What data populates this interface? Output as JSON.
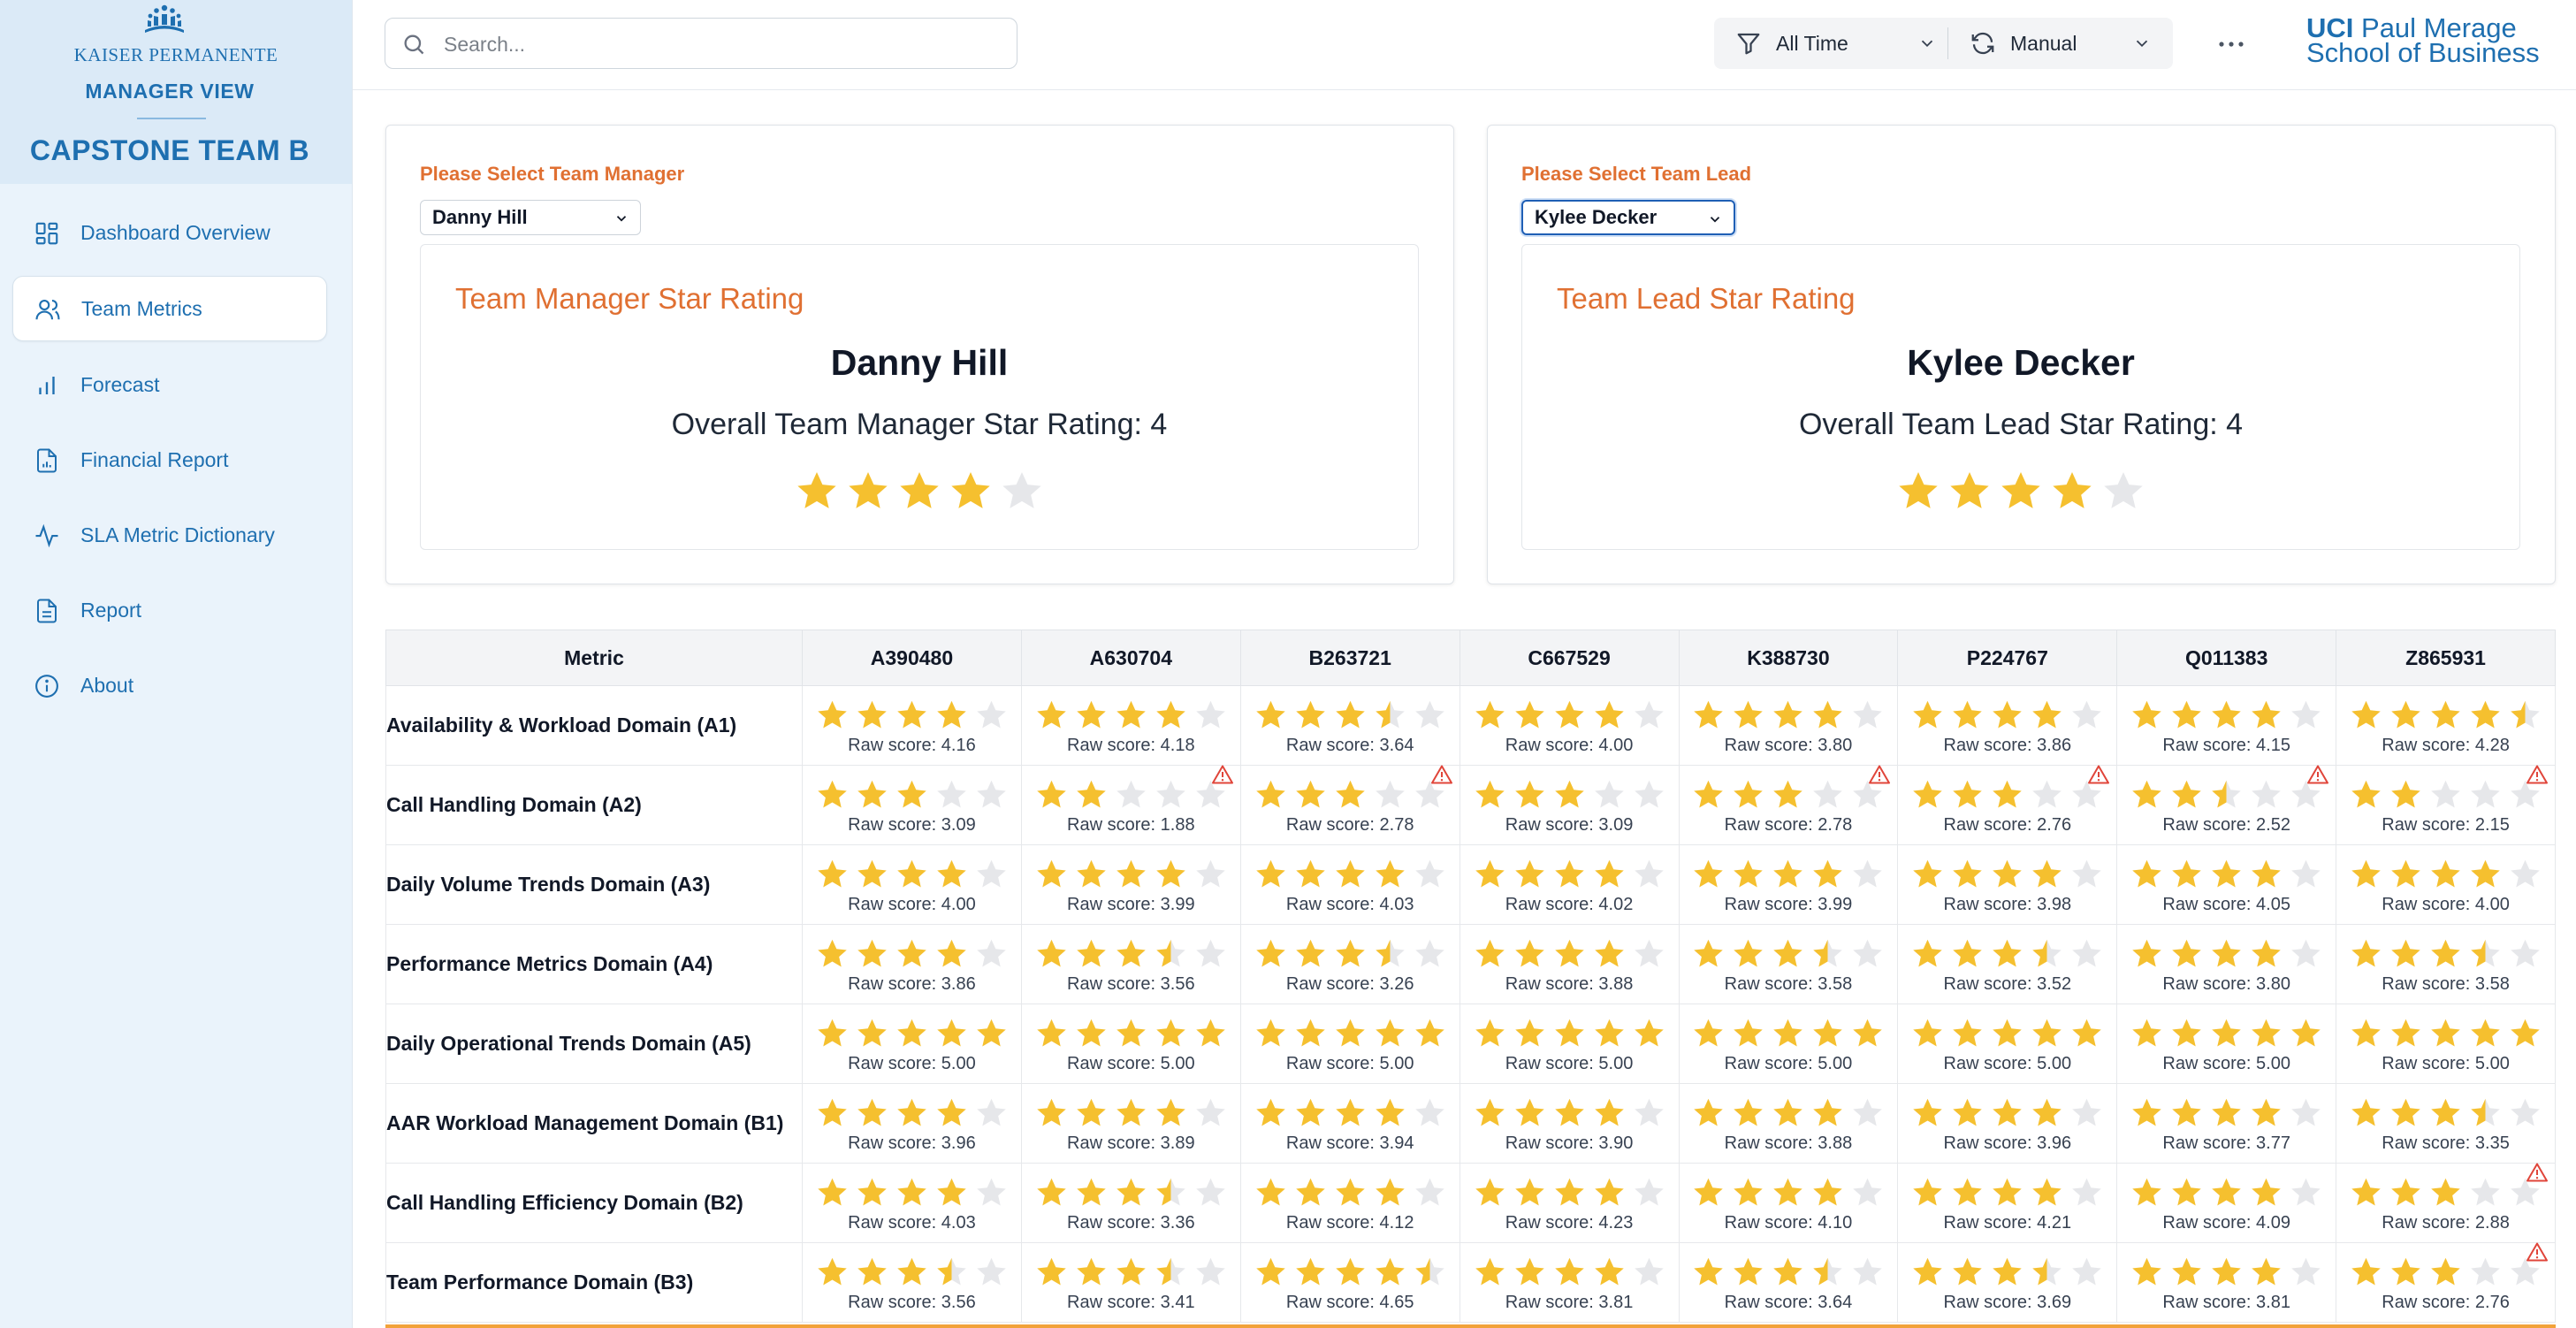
{
  "brand": {
    "org": "KAISER PERMANENTE",
    "view": "MANAGER VIEW",
    "team": "CAPSTONE TEAM B"
  },
  "nav": [
    {
      "label": "Dashboard Overview",
      "icon": "dashboard-icon",
      "active": false
    },
    {
      "label": "Team Metrics",
      "icon": "users-icon",
      "active": true
    },
    {
      "label": "Forecast",
      "icon": "bar-chart-icon",
      "active": false
    },
    {
      "label": "Financial Report",
      "icon": "file-chart-icon",
      "active": false
    },
    {
      "label": "SLA Metric Dictionary",
      "icon": "activity-icon",
      "active": false
    },
    {
      "label": "Report",
      "icon": "file-text-icon",
      "active": false
    },
    {
      "label": "About",
      "icon": "info-icon",
      "active": false
    }
  ],
  "header": {
    "search_placeholder": "Search...",
    "time_filter": "All Time",
    "refresh_mode": "Manual",
    "school_logo_line1_bold": "UCI",
    "school_logo_line1_rest": "Paul Merage",
    "school_logo_line2": "School of Business"
  },
  "manager_panel": {
    "select_label": "Please Select Team Manager",
    "selected": "Danny Hill",
    "card_title": "Team Manager Star Rating",
    "name": "Danny Hill",
    "overall_text": "Overall Team Manager Star Rating: 4",
    "rating": 4
  },
  "lead_panel": {
    "select_label": "Please Select Team Lead",
    "selected": "Kylee Decker",
    "card_title": "Team Lead Star Rating",
    "name": "Kylee Decker",
    "overall_text": "Overall Team Lead Star Rating: 4",
    "rating": 4
  },
  "table": {
    "metric_header": "Metric",
    "raw_prefix": "Raw score: ",
    "columns": [
      "A390480",
      "A630704",
      "B263721",
      "C667529",
      "K388730",
      "P224767",
      "Q011383",
      "Z865931"
    ],
    "rows": [
      {
        "metric": "Availability & Workload Domain (A1)",
        "cells": [
          {
            "stars": 4,
            "raw": "4.16",
            "warn": false
          },
          {
            "stars": 4,
            "raw": "4.18",
            "warn": false
          },
          {
            "stars": 3.5,
            "raw": "3.64",
            "warn": false
          },
          {
            "stars": 4,
            "raw": "4.00",
            "warn": false
          },
          {
            "stars": 4,
            "raw": "3.80",
            "warn": false
          },
          {
            "stars": 4,
            "raw": "3.86",
            "warn": false
          },
          {
            "stars": 4,
            "raw": "4.15",
            "warn": false
          },
          {
            "stars": 4.5,
            "raw": "4.28",
            "warn": false
          }
        ]
      },
      {
        "metric": "Call Handling Domain (A2)",
        "cells": [
          {
            "stars": 3,
            "raw": "3.09",
            "warn": false
          },
          {
            "stars": 2,
            "raw": "1.88",
            "warn": true
          },
          {
            "stars": 3,
            "raw": "2.78",
            "warn": true
          },
          {
            "stars": 3,
            "raw": "3.09",
            "warn": false
          },
          {
            "stars": 3,
            "raw": "2.78",
            "warn": true
          },
          {
            "stars": 3,
            "raw": "2.76",
            "warn": true
          },
          {
            "stars": 2.5,
            "raw": "2.52",
            "warn": true
          },
          {
            "stars": 2,
            "raw": "2.15",
            "warn": true
          }
        ]
      },
      {
        "metric": "Daily Volume Trends Domain (A3)",
        "cells": [
          {
            "stars": 4,
            "raw": "4.00",
            "warn": false
          },
          {
            "stars": 4,
            "raw": "3.99",
            "warn": false
          },
          {
            "stars": 4,
            "raw": "4.03",
            "warn": false
          },
          {
            "stars": 4,
            "raw": "4.02",
            "warn": false
          },
          {
            "stars": 4,
            "raw": "3.99",
            "warn": false
          },
          {
            "stars": 4,
            "raw": "3.98",
            "warn": false
          },
          {
            "stars": 4,
            "raw": "4.05",
            "warn": false
          },
          {
            "stars": 4,
            "raw": "4.00",
            "warn": false
          }
        ]
      },
      {
        "metric": "Performance Metrics Domain (A4)",
        "cells": [
          {
            "stars": 4,
            "raw": "3.86",
            "warn": false
          },
          {
            "stars": 3.5,
            "raw": "3.56",
            "warn": false
          },
          {
            "stars": 3.5,
            "raw": "3.26",
            "warn": false
          },
          {
            "stars": 4,
            "raw": "3.88",
            "warn": false
          },
          {
            "stars": 3.5,
            "raw": "3.58",
            "warn": false
          },
          {
            "stars": 3.5,
            "raw": "3.52",
            "warn": false
          },
          {
            "stars": 4,
            "raw": "3.80",
            "warn": false
          },
          {
            "stars": 3.5,
            "raw": "3.58",
            "warn": false
          }
        ]
      },
      {
        "metric": "Daily Operational Trends Domain (A5)",
        "cells": [
          {
            "stars": 5,
            "raw": "5.00",
            "warn": false
          },
          {
            "stars": 5,
            "raw": "5.00",
            "warn": false
          },
          {
            "stars": 5,
            "raw": "5.00",
            "warn": false
          },
          {
            "stars": 5,
            "raw": "5.00",
            "warn": false
          },
          {
            "stars": 5,
            "raw": "5.00",
            "warn": false
          },
          {
            "stars": 5,
            "raw": "5.00",
            "warn": false
          },
          {
            "stars": 5,
            "raw": "5.00",
            "warn": false
          },
          {
            "stars": 5,
            "raw": "5.00",
            "warn": false
          }
        ]
      },
      {
        "metric": "AAR Workload Management Domain (B1)",
        "cells": [
          {
            "stars": 4,
            "raw": "3.96",
            "warn": false
          },
          {
            "stars": 4,
            "raw": "3.89",
            "warn": false
          },
          {
            "stars": 4,
            "raw": "3.94",
            "warn": false
          },
          {
            "stars": 4,
            "raw": "3.90",
            "warn": false
          },
          {
            "stars": 4,
            "raw": "3.88",
            "warn": false
          },
          {
            "stars": 4,
            "raw": "3.96",
            "warn": false
          },
          {
            "stars": 4,
            "raw": "3.77",
            "warn": false
          },
          {
            "stars": 3.5,
            "raw": "3.35",
            "warn": false
          }
        ]
      },
      {
        "metric": "Call Handling Efficiency Domain (B2)",
        "cells": [
          {
            "stars": 4,
            "raw": "4.03",
            "warn": false
          },
          {
            "stars": 3.5,
            "raw": "3.36",
            "warn": false
          },
          {
            "stars": 4,
            "raw": "4.12",
            "warn": false
          },
          {
            "stars": 4,
            "raw": "4.23",
            "warn": false
          },
          {
            "stars": 4,
            "raw": "4.10",
            "warn": false
          },
          {
            "stars": 4,
            "raw": "4.21",
            "warn": false
          },
          {
            "stars": 4,
            "raw": "4.09",
            "warn": false
          },
          {
            "stars": 3,
            "raw": "2.88",
            "warn": true
          }
        ]
      },
      {
        "metric": "Team Performance Domain (B3)",
        "cells": [
          {
            "stars": 3.5,
            "raw": "3.56",
            "warn": false
          },
          {
            "stars": 3.5,
            "raw": "3.41",
            "warn": false
          },
          {
            "stars": 4.5,
            "raw": "4.65",
            "warn": false
          },
          {
            "stars": 4,
            "raw": "3.81",
            "warn": false
          },
          {
            "stars": 3.5,
            "raw": "3.64",
            "warn": false
          },
          {
            "stars": 3.5,
            "raw": "3.69",
            "warn": false
          },
          {
            "stars": 4,
            "raw": "3.81",
            "warn": false
          },
          {
            "stars": 3,
            "raw": "2.76",
            "warn": true
          }
        ]
      }
    ]
  },
  "colors": {
    "star": "#f5c02f",
    "star_empty": "#e6e7ea",
    "accent_orange": "#e07032",
    "brand_blue": "#1e6fb0",
    "warning_red": "#e0453a"
  }
}
